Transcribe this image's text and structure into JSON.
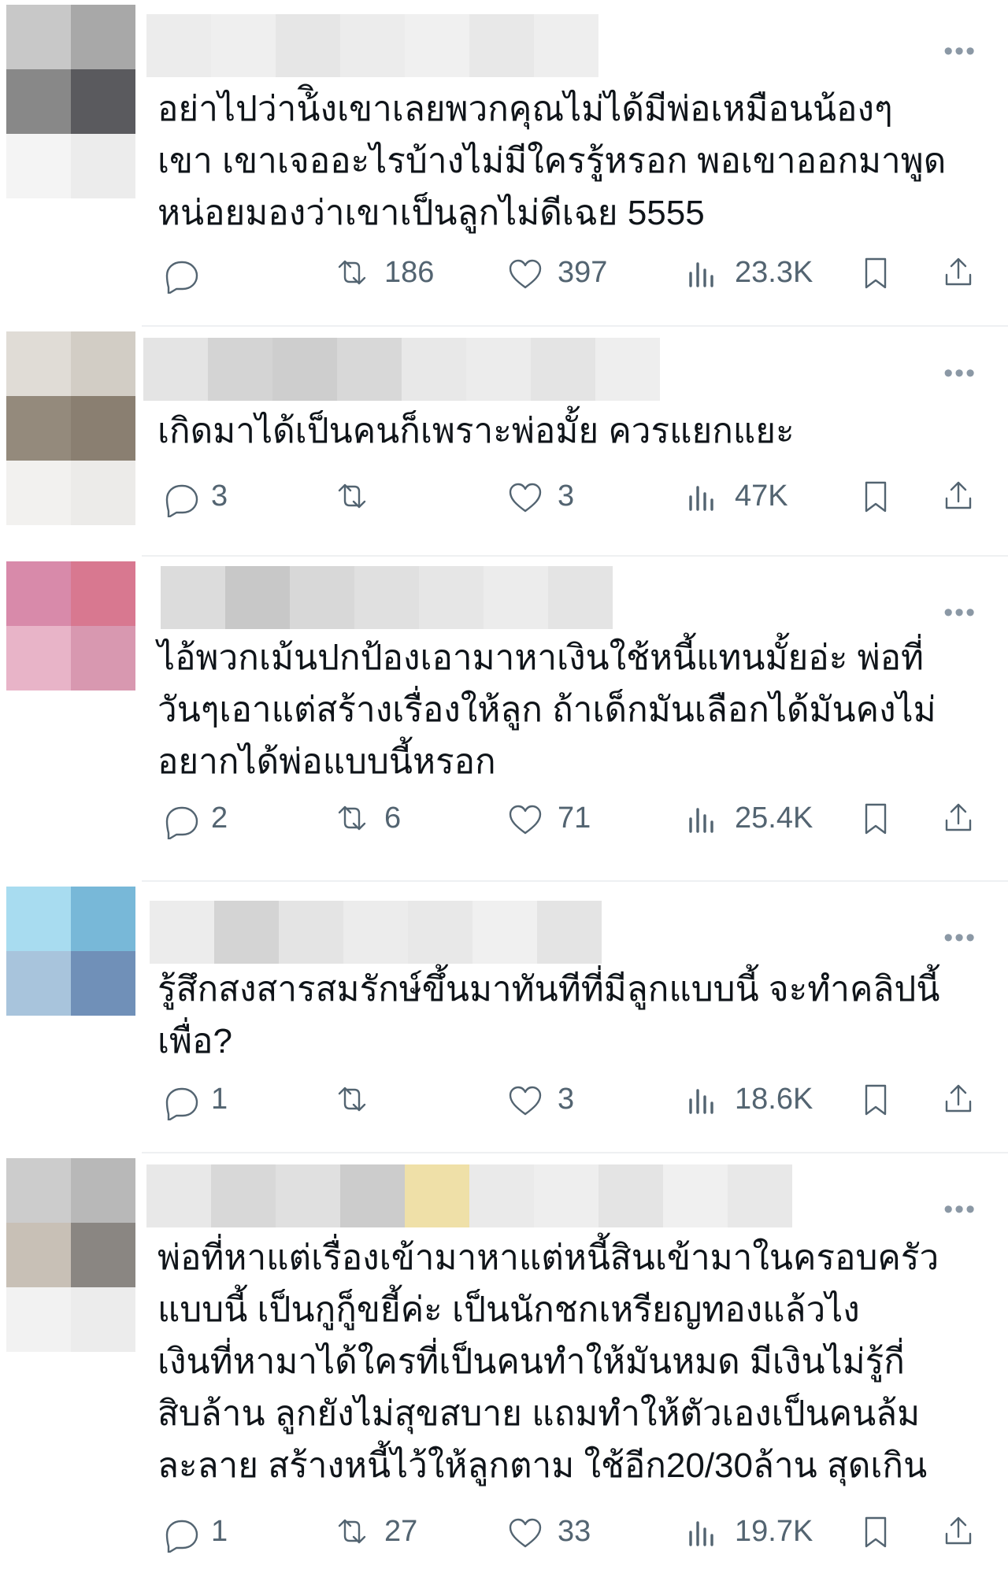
{
  "posts": [
    {
      "text": "อย่าไปว่าน้ิงเขาเลยพวกคุณไม่ได้มีพ่อเหมือนน้องๆ\nเขา เขาเจออะไรบ้างไม่มีใครรู้หรอก พอเขาออกมาพูด\nหน่อยมองว่าเขาเป็นลูกไม่ดีเฉย 5555",
      "replies": "",
      "retweets": "186",
      "likes": "397",
      "views": "23.3K",
      "avatar_colors": [
        "#c8c8c8",
        "#a8a8a8",
        "#888888",
        "#5a5a5e",
        "#f4f4f4",
        "#ececec"
      ],
      "name_colors": [
        "#ececec",
        "#efefef",
        "#e6e6e6",
        "#ececec",
        "#f0f0f0",
        "#e8e8e8",
        "#eeeeee"
      ]
    },
    {
      "text": "เกิดมาได้เป็นคนก็เพราะพ่อมั้ย ควรแยกแยะ",
      "replies": "3",
      "retweets": "",
      "likes": "3",
      "views": "47K",
      "avatar_colors": [
        "#e0dcd6",
        "#d2cdc5",
        "#948a7c",
        "#8a7f71",
        "#f2f1ef",
        "#ecebe9"
      ],
      "name_colors": [
        "#e4e4e4",
        "#d4d4d4",
        "#cecece",
        "#d8d8d8",
        "#e8e8e8",
        "#ececec",
        "#e4e4e4",
        "#eeeeee"
      ]
    },
    {
      "text": "ไอ้พวกเม้นปกป้องเอามาหาเงินใช้หนี้แทนมั้ยอ่ะ พ่อที่\nวันๆเอาแต่สร้างเรื่องให้ลูก ถ้าเด็กมันเลือกได้มันคงไม่\nอยากได้พ่อแบบนี้หรอก",
      "replies": "2",
      "retweets": "6",
      "likes": "71",
      "views": "25.4K",
      "avatar_colors": [
        "#d88aaa",
        "#d87890",
        "#e8b4c8",
        "#d898b0",
        "#ffffff",
        "#ffffff"
      ],
      "name_colors": [
        "#dcdcdc",
        "#c8c8c8",
        "#d8d8d8",
        "#e0e0e0",
        "#e6e6e6",
        "#ececec",
        "#e4e4e4"
      ]
    },
    {
      "text": "รู้สึกสงสารสมรักษ์ขึ้นมาทันทีที่มีลูกแบบนี้ จะทำคลิปนี้\nเพื่อ?",
      "replies": "1",
      "retweets": "",
      "likes": "3",
      "views": "18.6K",
      "avatar_colors": [
        "#a8dcf0",
        "#78b8d8",
        "#a8c4dc",
        "#7090b8",
        "#ffffff",
        "#ffffff"
      ],
      "name_colors": [
        "#ececec",
        "#d4d4d4",
        "#e4e4e4",
        "#ececec",
        "#e8e8e8",
        "#f0f0f0",
        "#e4e4e4"
      ]
    },
    {
      "text": "พ่อที่หาแต่เรื่องเข้ามาหาแต่หนี้สินเข้ามาในครอบครัว\nแบบนี้ เป็นกูกู็ขยี้ค่ะ เป็นนักชกเหรียญทองแล้วไง\nเงินที่หามาได้ใครที่เป็นคนทำให้มันหมด มีเงินไม่รู้กี่\nสิบล้าน ลูกยังไม่สุขสบาย แถมทำให้ตัวเองเป็นคนล้ม\nละลาย สร้างหนี้ไว้ให้ลูกตาม ใช้อีก20/30ล้าน สุดเกิน",
      "replies": "1",
      "retweets": "27",
      "likes": "33",
      "views": "19.7K",
      "avatar_colors": [
        "#cccccc",
        "#b8b8b8",
        "#c8c0b6",
        "#8a8682",
        "#f2f2f2",
        "#ececec"
      ],
      "name_colors": [
        "#e8e8e8",
        "#d8d8d8",
        "#e0e0e0",
        "#cccccc",
        "#efe0a8",
        "#eaeaea",
        "#eeeeee",
        "#e4e4e4",
        "#f0f0f0",
        "#e8e8e8"
      ]
    }
  ],
  "more_label": "•••",
  "icons": {
    "reply": "reply-icon",
    "retweet": "retweet-icon",
    "like": "heart-icon",
    "views": "views-chart-icon",
    "bookmark": "bookmark-icon",
    "share": "share-icon"
  }
}
